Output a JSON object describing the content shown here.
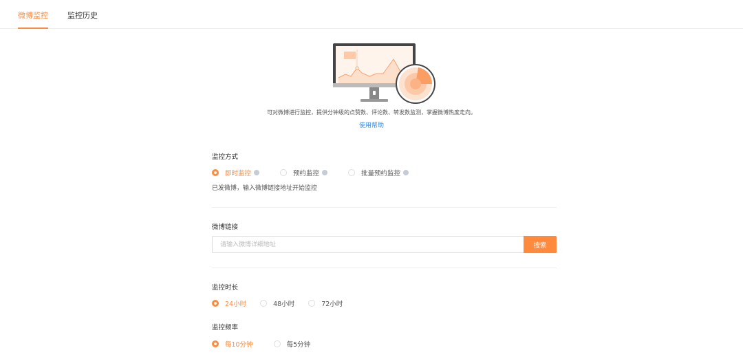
{
  "tabs": [
    {
      "label": "微博监控",
      "active": true
    },
    {
      "label": "监控历史",
      "active": false
    }
  ],
  "intro": {
    "description": "可对微博进行监控，提供分钟级的点赞数、评论数、转发数监测，掌握微博热度走向。",
    "help_link": "使用帮助"
  },
  "monitor_mode": {
    "label": "监控方式",
    "options": [
      {
        "label": "即时监控",
        "selected": true
      },
      {
        "label": "预约监控",
        "selected": false
      },
      {
        "label": "批量预约监控",
        "selected": false
      }
    ],
    "hint": "已发微博，输入微博链接地址开始监控"
  },
  "link": {
    "label": "微博链接",
    "placeholder": "请输入微博详细地址",
    "value": "",
    "button": "搜索"
  },
  "duration": {
    "label": "监控时长",
    "options": [
      {
        "label": "24小时",
        "selected": true
      },
      {
        "label": "48小时",
        "selected": false
      },
      {
        "label": "72小时",
        "selected": false
      }
    ]
  },
  "frequency": {
    "label": "监控频率",
    "options": [
      {
        "label": "每10分钟",
        "selected": true
      },
      {
        "label": "每5分钟",
        "selected": false
      }
    ]
  },
  "colors": {
    "accent": "#ff8a3d",
    "link": "#3a8ee6"
  }
}
